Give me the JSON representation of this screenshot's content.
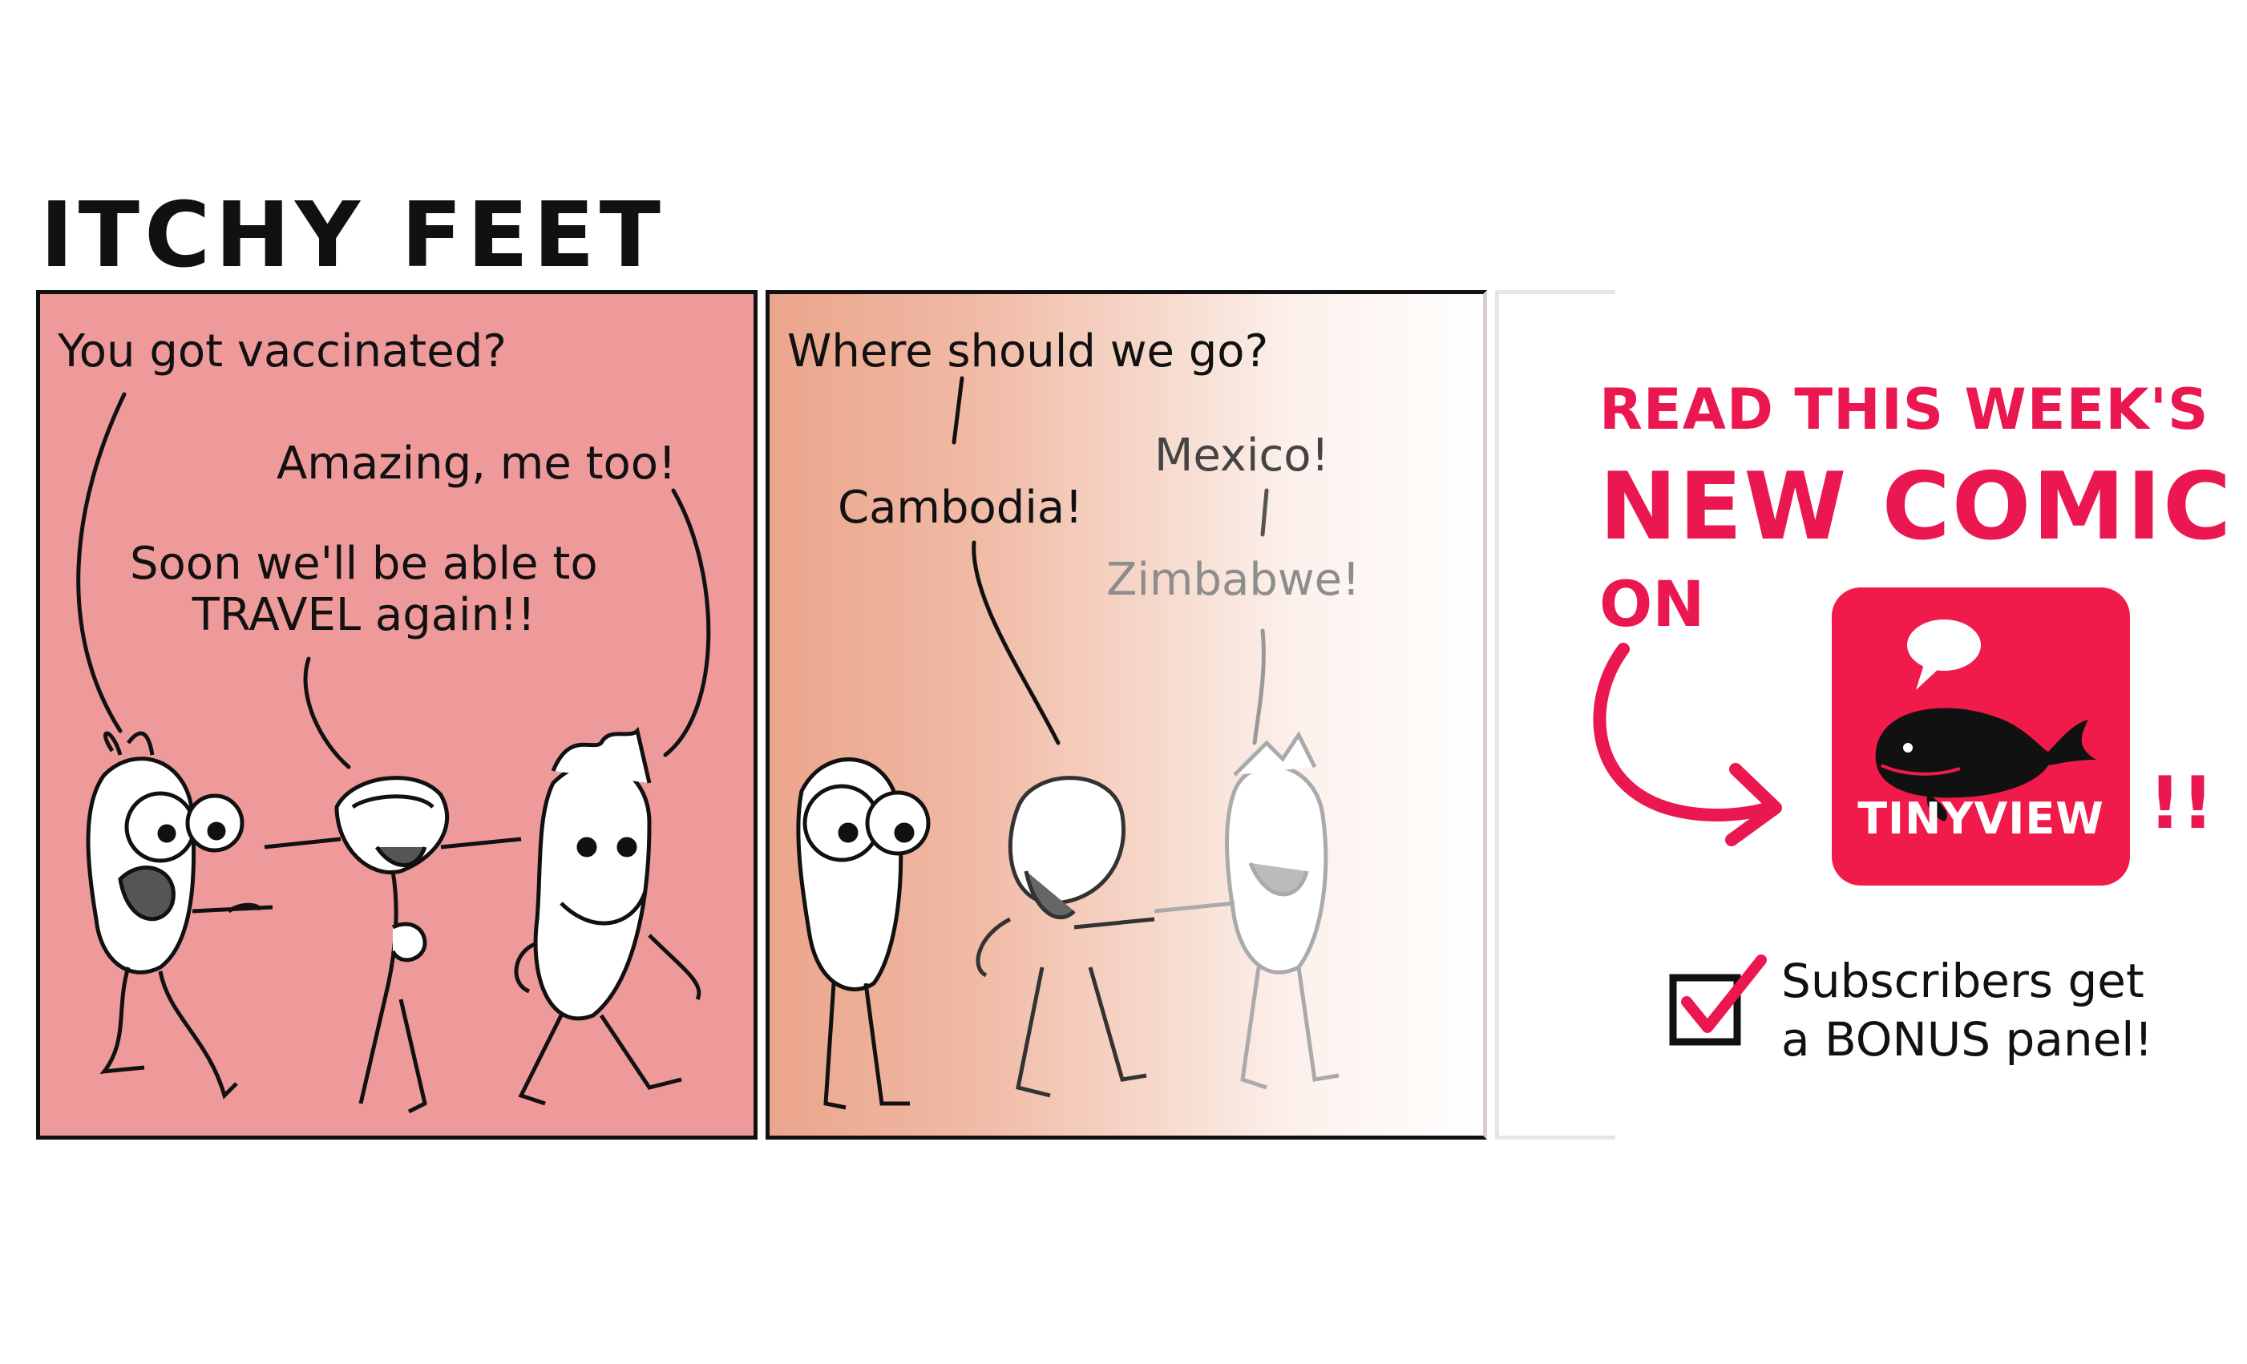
{
  "title": "ITCHY FEET",
  "panel1": {
    "bubbles": [
      "You got vaccinated?",
      "Amazing, me too!",
      "Soon we'll be able to\nTRAVEL again!!"
    ]
  },
  "panel2": {
    "bubbles": [
      "Where should we go?",
      "Cambodia!",
      "Mexico!",
      "Zimbabwe!"
    ]
  },
  "promo": {
    "line1": "READ THIS WEEK'S",
    "line2": "NEW COMIC",
    "line3": "ON",
    "app_name": "TINYVIEW",
    "exclaim": "!!",
    "subscriber_note": "Subscribers get\na BONUS panel!",
    "accent_color": "#ea1750",
    "icons": [
      "whale-icon",
      "speech-bubble-icon",
      "curved-arrow-icon",
      "checkbox-icon"
    ]
  },
  "colors": {
    "panel1_bg": "#ee9a9a",
    "panel2_bg": "#eba58c",
    "tile_bg": "#f01a4b"
  }
}
